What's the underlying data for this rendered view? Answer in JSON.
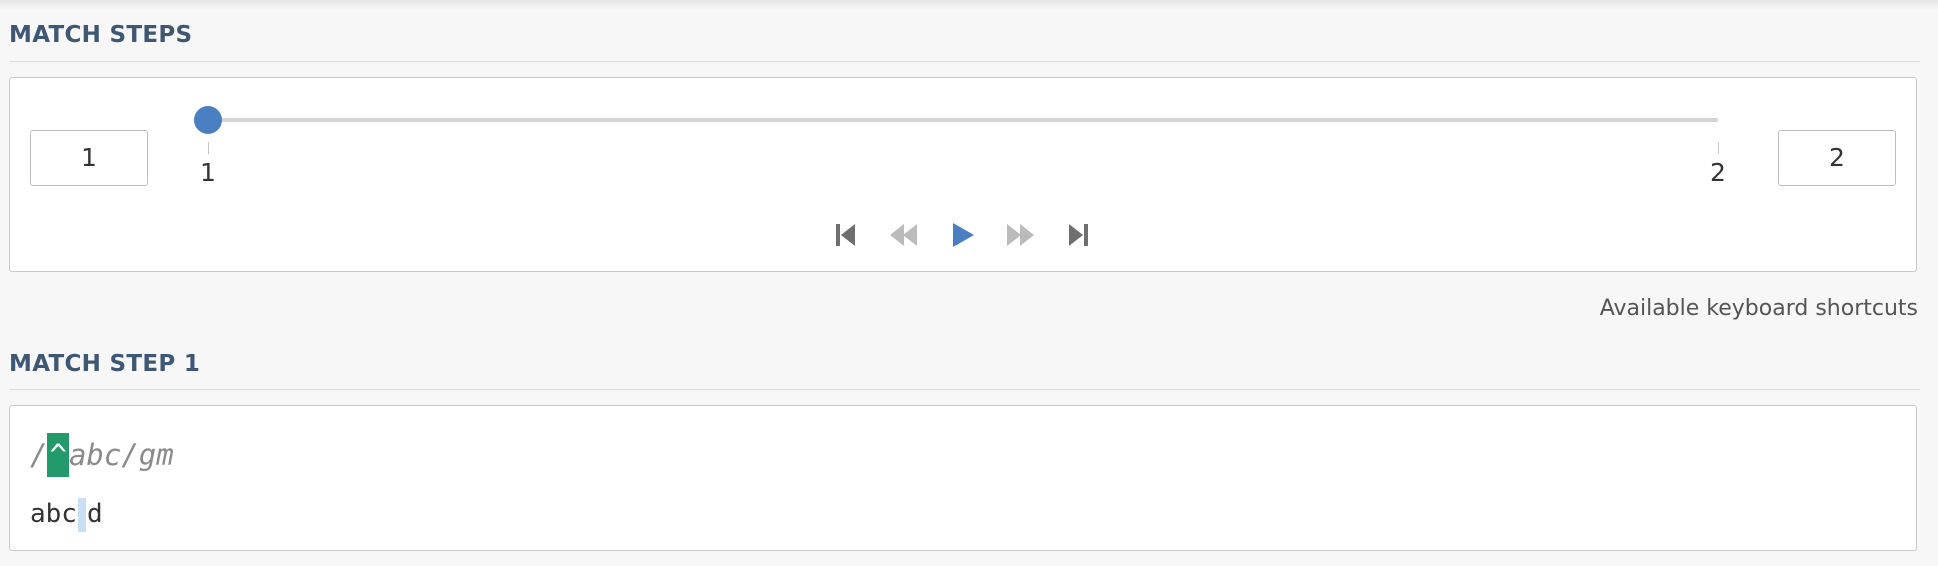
{
  "match_steps": {
    "title": "MATCH STEPS",
    "current_step": "1",
    "total_steps": "2",
    "slider": {
      "min_label": "1",
      "max_label": "2",
      "value": 1,
      "min": 1,
      "max": 2
    },
    "controls": [
      {
        "name": "first-step-icon",
        "state": "enabled"
      },
      {
        "name": "previous-step-icon",
        "state": "disabled"
      },
      {
        "name": "play-icon",
        "state": "active"
      },
      {
        "name": "next-step-icon",
        "state": "disabled"
      },
      {
        "name": "last-step-icon",
        "state": "enabled"
      }
    ]
  },
  "shortcuts": {
    "label": "Available keyboard shortcuts"
  },
  "match_step_detail": {
    "title": "MATCH STEP 1",
    "regex": {
      "prefix": "/",
      "highlight": "^",
      "suffix": "abc/gm"
    },
    "subject": {
      "before": "abc",
      "after": "d"
    }
  },
  "colors": {
    "heading": "#3e5775",
    "accent": "#4a7fc1",
    "match_highlight": "#239a6c",
    "cursor_highlight": "#c8dff5",
    "disabled_control": "#bbbbbb",
    "enabled_control": "#6f6f6f"
  }
}
